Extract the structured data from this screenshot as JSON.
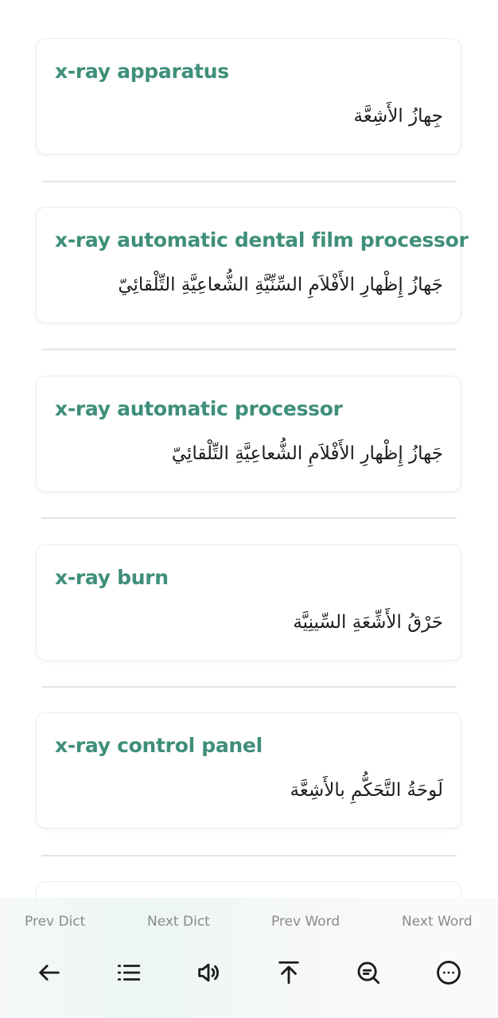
{
  "entries": [
    {
      "en": "x-ray apparatus",
      "ar": "جِهازُ الأَشِعَّة"
    },
    {
      "en": "x-ray automatic dental film processor",
      "ar": "جَهازُ إِظْهارِ الأَفْلاَمِ السِّنِّيَّةِ الشُّعاعِيَّةِ التِّلْقائِيّ"
    },
    {
      "en": "x-ray automatic processor",
      "ar": "جَهازُ إِظْهارِ الأَفْلاَمِ الشُّعاعِيَّةِ التِّلْقائِيّ"
    },
    {
      "en": "x-ray burn",
      "ar": "حَرْقُ الأَشِّعَةِ السِّينِيَّة"
    },
    {
      "en": "x-ray control panel",
      "ar": "لَوحَةُ التَّحَكُّمِ بالأَشِعَّة"
    }
  ],
  "bottom_nav": {
    "prev_dict": "Prev Dict",
    "next_dict": "Next Dict",
    "prev_word": "Prev Word",
    "next_word": "Next Word"
  },
  "toolbar_icons": [
    "back-arrow-icon",
    "list-icon",
    "speaker-icon",
    "scroll-top-icon",
    "search-zoom-icon",
    "more-icon"
  ],
  "colors": {
    "accent": "#3f8f7a",
    "text": "#1c1c1c",
    "muted": "#8a8a8a"
  }
}
